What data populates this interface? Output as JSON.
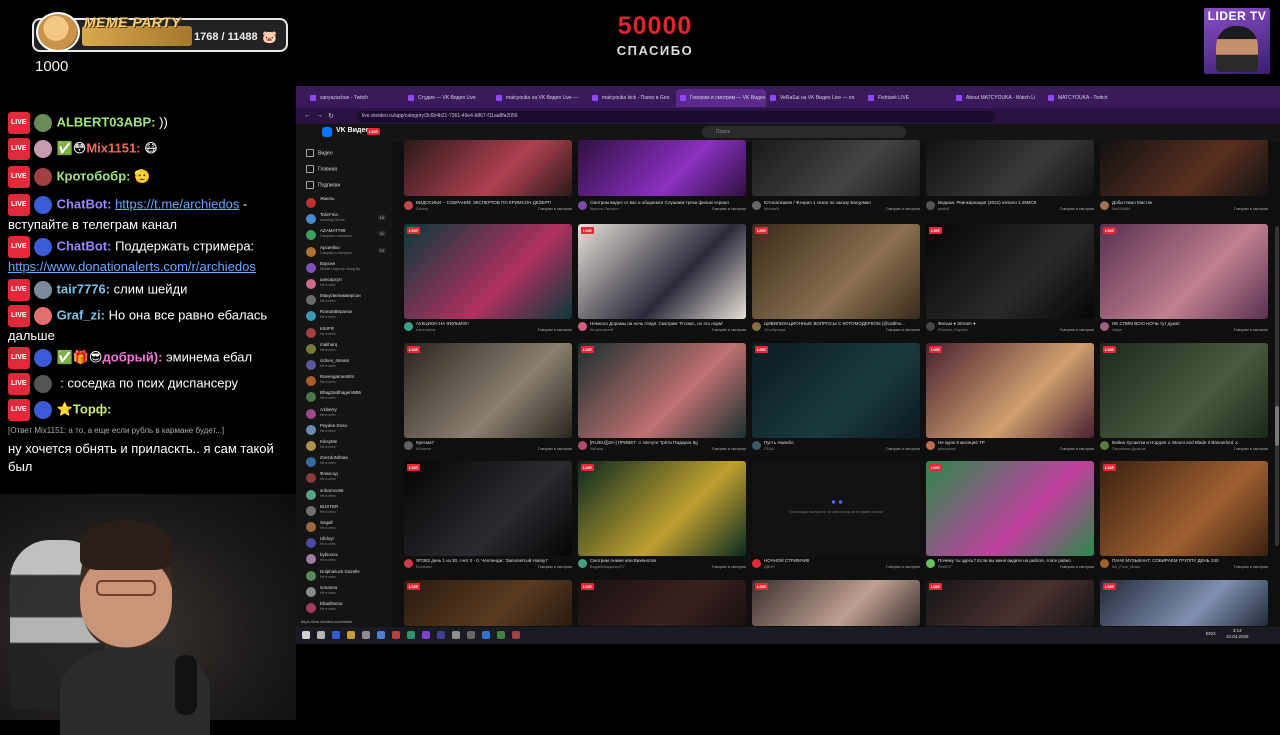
{
  "overlay": {
    "meme_title": "MEME PARTY",
    "meme_progress": "1768 / 11488",
    "meme_value": "1000",
    "goal_number": "50000",
    "goal_caption": "СПАСИБО",
    "lider_title": "LIDER TV"
  },
  "chat": [
    {
      "nick": "ALBERT03ABP:",
      "nick_color": "#9ee67b",
      "text": "))",
      "avatar_color": "#6b8a5a"
    },
    {
      "nick": "Mix1151:",
      "nick_color": "#f06a5a",
      "text": "😷",
      "avatar_color": "#c89ab0",
      "emotes": "✅😳"
    },
    {
      "nick": "Кротобобр:",
      "nick_color": "#9ee67b",
      "text": "🫡",
      "avatar_color": "#a04040"
    },
    {
      "nick": "ChatBot:",
      "nick_color": "#9b86ff",
      "text": "-",
      "link": "https://t.me/archiedos",
      "cont": "вступайте в телеграм канал"
    },
    {
      "nick": "ChatBot:",
      "nick_color": "#9b86ff",
      "text": "Поддержать стримера:",
      "link": "https://www.donationalerts.com/r/archiedos"
    },
    {
      "nick": "tair7776:",
      "nick_color": "#7fc0e8",
      "text": "слим шейди",
      "avatar_color": "#7a8a9a"
    },
    {
      "nick": "Graf_zi:",
      "nick_color": "#7fc0e8",
      "text": "Но она все равно ебалась",
      "cont": "дальше",
      "avatar_color": "#e07070"
    },
    {
      "nick": "добрый):",
      "nick_color": "#f07ad8",
      "text": "эминема ебал",
      "emotes": "✅🎁😎"
    },
    {
      "nick": "",
      "text": ": соседка по псих диспансеру",
      "avatar_color": "#555"
    },
    {
      "nick": "Торф:",
      "nick_color": "#c9e87b",
      "text": "",
      "emotes": "⭐"
    },
    {
      "reply": "[Ответ Mix1151: а то, а еще если рубль в кармане будет...]",
      "text": "ну хочется обнять и приласкть.. я сам такой",
      "cont": "был"
    }
  ],
  "browser": {
    "tabs": [
      {
        "label": "sanyazachan - Twitch"
      },
      {
        "label": "Студия — VK Видео Live"
      },
      {
        "label": "matcyouka на VK Видео Live —"
      },
      {
        "label": "matcyouka kick - Поиск в Goo"
      },
      {
        "label": "Говорим и смотрим — VK Видео",
        "active": true
      },
      {
        "label": "VeRaSai на VK Видео Live — on"
      },
      {
        "label": "Fishtank LIVE"
      },
      {
        "label": "About MATCYOUKA - Watch Li"
      },
      {
        "label": "MATCYOUKA - Twitch"
      }
    ],
    "url": "live.vkvideo.ru/app/category/3c6b4b21-7361-49e4-b867-f11aa8fa2056",
    "status_url": "https://live.vkvideo.ru/vellalai"
  },
  "vk": {
    "brand": "VK Видео",
    "live_tag": "LIVE",
    "search_placeholder": "Поиск",
    "nav": [
      "Видео",
      "Главная",
      "Подписки"
    ],
    "channels": [
      {
        "name": "Жмель",
        "sub": "",
        "num": ""
      },
      {
        "name": "TalicFriia",
        "sub": "Amazing Online",
        "num": "15"
      },
      {
        "name": "AZAMAT799",
        "sub": "Говорим и смотрим",
        "num": "11"
      },
      {
        "name": "Арсиябко",
        "sub": "Говорим и смотрим",
        "num": "13"
      },
      {
        "name": "Вэрсни",
        "sub": "Mobile Legends: Bang Ba",
        "num": ""
      },
      {
        "name": "алисарсуп",
        "sub": "Не в сети",
        "num": ""
      },
      {
        "name": "Макусвелиюверсон",
        "sub": "Не в сети",
        "num": ""
      },
      {
        "name": "RomanBirpanov",
        "sub": "Не в сети",
        "num": ""
      },
      {
        "name": "K84FR",
        "sub": "Не в сети",
        "num": ""
      },
      {
        "name": "maliharq",
        "sub": "Не в сети",
        "num": ""
      },
      {
        "name": "cidnes_stream",
        "sub": "Не в сети",
        "num": ""
      },
      {
        "name": "Ravengames904",
        "sub": "Не в сети",
        "num": ""
      },
      {
        "name": "Bhag2atdhagem9B5",
        "sub": "Не в сети",
        "num": ""
      },
      {
        "name": "A1iberry",
        "sub": "Не в сети",
        "num": ""
      },
      {
        "name": "Paydee Dosu",
        "sub": "Не в сети",
        "num": ""
      },
      {
        "name": "KlesyMe",
        "sub": "Не в сети",
        "num": ""
      },
      {
        "name": "ZvezdoNihtaa",
        "sub": "Не в сети",
        "num": ""
      },
      {
        "name": "Флексод",
        "sub": "Не в сети",
        "num": ""
      },
      {
        "name": "soharovo66",
        "sub": "Не в сети",
        "num": ""
      },
      {
        "name": "BUSTER",
        "sub": "Не в сети",
        "num": ""
      },
      {
        "name": "Segall",
        "sub": "Не в сети",
        "num": ""
      },
      {
        "name": "Ulldoyr",
        "sub": "Не в сети",
        "num": ""
      },
      {
        "name": "bybiooxx",
        "sub": "Не в сети",
        "num": ""
      },
      {
        "name": "Dolphieluck Gazelle",
        "sub": "Не в сети",
        "num": ""
      },
      {
        "name": "sonanea",
        "sub": "Не в сети",
        "num": ""
      },
      {
        "name": "Ebaditsena",
        "sub": "Не в сети",
        "num": ""
      }
    ],
    "cards": [
      {
        "title": "ВИДОСИКИ -- СОБРАНИЕ ЭКСПЕРТОВ ПО КРИМСОН ДЕЗЕРТ!",
        "channel": "Drinery",
        "category": "Говорим и смотрим",
        "live": "",
        "colors": [
          "#2a1a1a",
          "#b04050"
        ],
        "avatar": "#c04a4a"
      },
      {
        "title": "Смотрим видео от вас и общаемся Слушаем треки фильм сериал",
        "channel": "Кирилл Смотрит",
        "category": "Говорим и смотрим",
        "live": "",
        "colors": [
          "#301040",
          "#8a30c0"
        ],
        "avatar": "#7a4aa0"
      },
      {
        "title": "Ютопалкакия / Фэнрил 1 сезон по заказу Басурман",
        "channel": "Michael5",
        "category": "Говорим и смотрим",
        "live": "",
        "colors": [
          "#1a1a1a",
          "#444"
        ],
        "avatar": "#666"
      },
      {
        "title": "Ведьма: Реинкарнация (2022) начало 1:48МСК",
        "channel": "phalz8",
        "category": "Говорим и смотрим",
        "live": "",
        "colors": [
          "#111",
          "#3a3a3a"
        ],
        "avatar": "#555"
      },
      {
        "title": "Добыттмал Мастяк",
        "channel": "NoSZ6684",
        "category": "Говорим и смотрим",
        "live": "",
        "colors": [
          "#111",
          "#5a3020"
        ],
        "avatar": "#a07050"
      },
      {
        "title": "АУКЦИОН НА ФИЛЬМ!!!!!",
        "channel": "Leturotahia",
        "category": "Говорим и смотрим",
        "live": "LIVE",
        "colors": [
          "#0a3a3a",
          "#b03060"
        ],
        "avatar": "#3aa08a"
      },
      {
        "title": "Немного Дорамы на ночь глядя. Смотрим 'Я поюс, но это норм'",
        "channel": "Kirupinoliprett",
        "category": "Говорим и смотрим",
        "live": "LIVE",
        "colors": [
          "#e8e0d8",
          "#2a2a3a"
        ],
        "avatar": "#d06080"
      },
      {
        "title": "ЦИВИЛИЗАЦИОННЫЕ ВОПРОСЫ С КОТОМОДЕРКОМ (@catfmo...",
        "channel": "Отсобушарь",
        "category": "Говорим и смотрим",
        "live": "LIVE",
        "colors": [
          "#3a2a1a",
          "#8a7050"
        ],
        "avatar": "#8a6a40"
      },
      {
        "title": "Фильм ● Stream ●",
        "channel": "Phoenix_Hnyrdon",
        "category": "Говорим и смотрим",
        "live": "LIVE",
        "colors": [
          "#050505",
          "#2a2a2a"
        ],
        "avatar": "#444"
      },
      {
        "title": "НЕ СПИМ ВСЮ НОЧЬ тут думат",
        "channel": "Jakpe",
        "category": "Говорим и смотрим",
        "live": "LIVE",
        "colors": [
          "#5a3050",
          "#c08090"
        ],
        "avatar": "#a06080"
      },
      {
        "title": "Кресма7",
        "channel": "Ш0чинге",
        "category": "Говорим и смотрим",
        "live": "LIVE",
        "colors": [
          "#2a2520",
          "#8a8070"
        ],
        "avatar": "#606060"
      },
      {
        "title": "[RU/EU][18+] ПРИВЕТ ☺ Мочуте Трёти Пмдарок 9g",
        "channel": "VeRaiai",
        "category": "Говорим и смотрим",
        "live": "LIVE",
        "colors": [
          "#1a3030",
          "#c07070"
        ],
        "avatar": "#b04a70"
      },
      {
        "title": "Пусть Аманбо",
        "channel": "СЕАХ",
        "category": "Говорим и смотрим",
        "live": "LIVE",
        "colors": [
          "#0a1a20",
          "#1a3a40"
        ],
        "avatar": "#3a5a6a"
      },
      {
        "title": "Не курю 9 месяцев ТР",
        "channel": "pitruoabek",
        "category": "Говорим и смотрим",
        "live": "LIVE",
        "colors": [
          "#4a2030",
          "#d0a070"
        ],
        "avatar": "#c07050"
      },
      {
        "title": "Война Хусаитки и Нордов ⚔ Mount and Blade II Bannerlord ⚔",
        "channel": "Потоклипп Дальше",
        "category": "Говорим и смотрим",
        "live": "LIVE",
        "colors": [
          "#1a2a1a",
          "#4a5a40"
        ],
        "avatar": "#5a7a40"
      },
      {
        "title": "ЯП382 день 1 из 30, счет 0 - 0. Челлендж: 'Заполнятый Новоут'",
        "channel": "Ботонаш",
        "category": "Говорим и смотрим",
        "live": "LIVE",
        "colors": [
          "#050505",
          "#2a2a30"
        ],
        "avatar": "#d03a4a"
      },
      {
        "title": "Смотрим Аниме или Вихенотов",
        "channel": "ВэдыВнешдиперТУ",
        "category": "Говорим и смотрим",
        "live": "LIVE",
        "colors": [
          "#0a2a20",
          "#c0a030"
        ],
        "avatar": "#40a080"
      },
      {
        "title": "НОЧНОЙ СТРИМЧИК",
        "channel": "ДВНН",
        "category": "Говорим и смотрим",
        "live": "",
        "colors": [
          "#121212",
          "#121212"
        ],
        "avatar": "#e02a3a"
      },
      {
        "title": "Почему ты здесь? Если вы меня видите на работе, я все равно",
        "channel": "Red0ST",
        "category": "Говорим и смотрим",
        "live": "LIVE",
        "colors": [
          "#2a8a4a",
          "#c040a0"
        ],
        "avatar": "#6ac060"
      },
      {
        "title": "ПАНК МУЗЫКАНТ. СОБИРАЕМ ГРУППУ ДЕНЬ 240",
        "channel": "AC_Punk_Music",
        "category": "Говорим и смотрим",
        "live": "LIVE",
        "colors": [
          "#3a2010",
          "#a06030"
        ],
        "avatar": "#a06030"
      },
      {
        "title": "",
        "channel": "",
        "category": "",
        "live": "LIVE",
        "colors": [
          "#2a1a10",
          "#5a3a20"
        ],
        "avatar": "#333"
      },
      {
        "title": "",
        "channel": "",
        "category": "",
        "live": "LIVE",
        "colors": [
          "#1a1010",
          "#3a2020"
        ],
        "avatar": "#333"
      },
      {
        "title": "",
        "channel": "",
        "category": "",
        "live": "LIVE",
        "colors": [
          "#3a3030",
          "#c0a090"
        ],
        "avatar": "#333"
      },
      {
        "title": "",
        "channel": "",
        "category": "",
        "live": "LIVE",
        "colors": [
          "#151515",
          "#4a3030"
        ],
        "avatar": "#333"
      },
      {
        "title": "",
        "channel": "",
        "category": "",
        "live": "LIVE",
        "colors": [
          "#202a3a",
          "#8090b0"
        ],
        "avatar": "#333"
      }
    ],
    "loading_text": "Трансляция настроена по очеи пьесы на ее фазнх провсн",
    "clock_time": "3:14",
    "clock_date": "10.04.2026",
    "lang": "ENG"
  }
}
